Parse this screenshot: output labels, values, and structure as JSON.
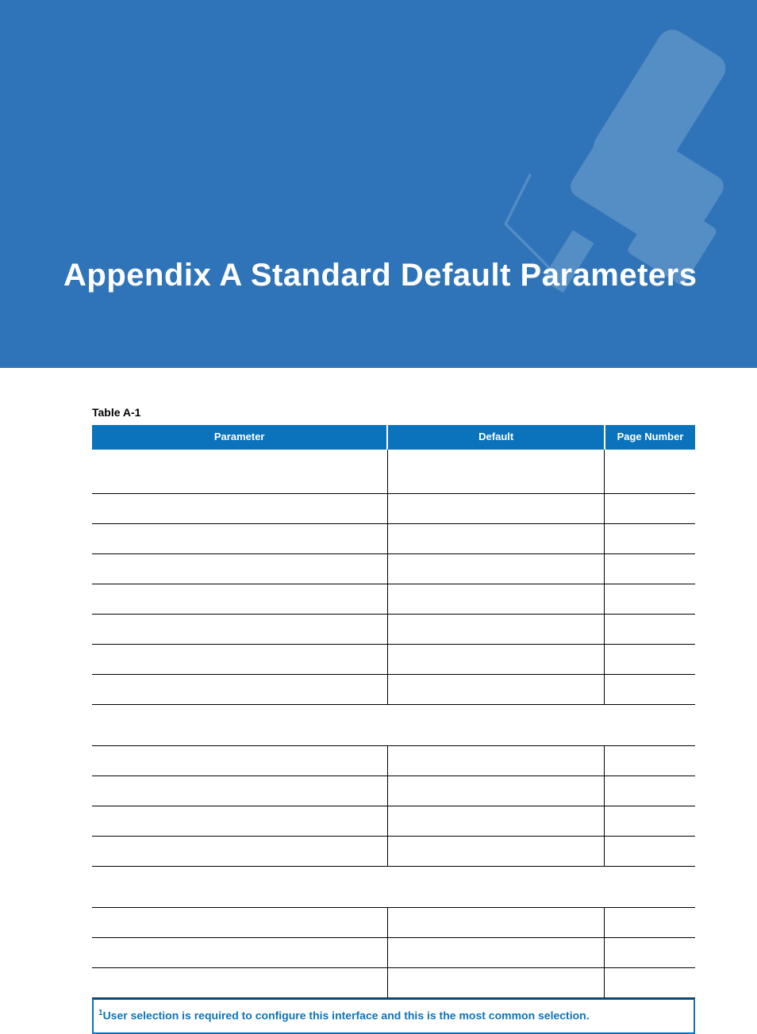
{
  "banner": {
    "title": "Appendix A  Standard Default Parameters"
  },
  "table": {
    "label": "Table A-1",
    "headers": {
      "parameter": "Parameter",
      "default": "Default",
      "page": "Page Number"
    }
  },
  "footnote": {
    "marker": "1",
    "text": "User selection is required to configure this interface and this is the most common selection."
  }
}
